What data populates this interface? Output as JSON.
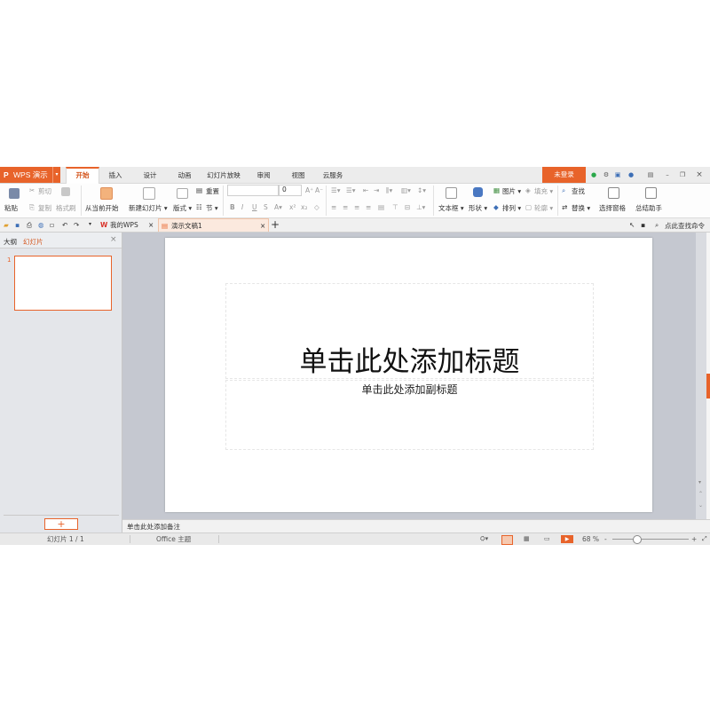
{
  "app": {
    "button_icon": "P",
    "button_label": "WPS 演示",
    "dropdown_arrow": "▾"
  },
  "menu_tabs": [
    "开始",
    "插入",
    "设计",
    "动画",
    "幻灯片放映",
    "审阅",
    "视图",
    "云服务"
  ],
  "login_label": "未登录",
  "window_controls": {
    "minimize": "–",
    "restore": "❐",
    "close": "×"
  },
  "ribbon": {
    "paste": "粘贴",
    "cut": "剪切",
    "copy": "复制",
    "format_painter": "格式刷",
    "from_current": "从当前开始",
    "new_slide": "新建幻灯片",
    "layout": "版式",
    "reset": "重置",
    "section": "节",
    "font_size": "0",
    "text_box": "文本框",
    "shape": "形状",
    "picture": "图片",
    "fill": "填充",
    "arrange": "排列",
    "outline": "轮廓",
    "find": "查找",
    "replace": "替换",
    "selection_pane": "选择窗格",
    "summary_assistant": "总结助手"
  },
  "doc_tabs": {
    "my_wps": "我的WPS",
    "document": "演示文稿1",
    "close": "×",
    "add": "+"
  },
  "command_search": "点此查找命令",
  "left_panel": {
    "tab_outline": "大纲",
    "tab_slides": "幻灯片",
    "close": "×",
    "slide_number": "1",
    "add_button": "+"
  },
  "slide": {
    "title_placeholder": "单击此处添加标题",
    "subtitle_placeholder": "单击此处添加副标题"
  },
  "notes_placeholder": "单击此处添加备注",
  "status_bar": {
    "slide_counter": "幻灯片 1 / 1",
    "theme": "Office 主题",
    "zoom": "68 %",
    "zoom_minus": "-",
    "zoom_plus": "+"
  },
  "colors": {
    "accent": "#e8632a",
    "workspace": "#c5c8d0",
    "panel": "#e4e6ea"
  }
}
